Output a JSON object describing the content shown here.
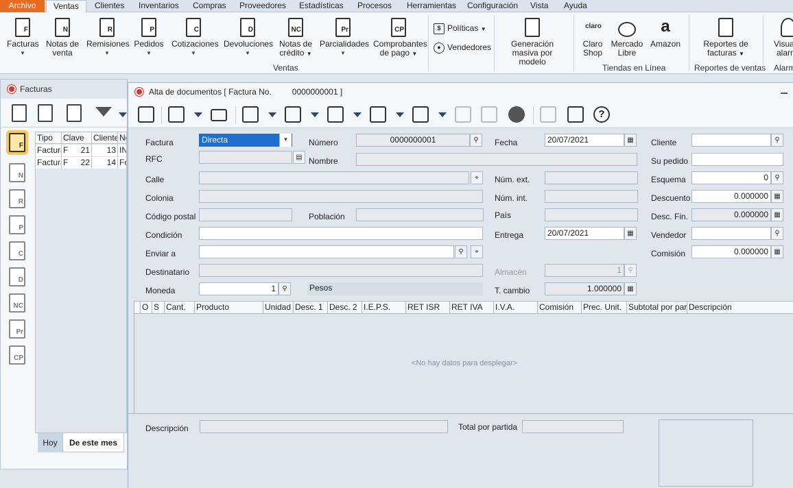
{
  "menu": {
    "tabs": [
      "Archivo",
      "Ventas",
      "Clientes",
      "Inventarios",
      "Compras",
      "Proveedores",
      "Estadísticas",
      "Procesos",
      "Herramientas",
      "Configuración",
      "Vista",
      "Ayuda"
    ]
  },
  "ribbon": {
    "facturas": {
      "label": "Facturas",
      "glyph": "F"
    },
    "notas_venta": {
      "label1": "Notas de",
      "label2": "venta",
      "glyph": "N"
    },
    "remisiones": {
      "label": "Remisiones",
      "glyph": "R"
    },
    "pedidos": {
      "label": "Pedidos",
      "glyph": "P"
    },
    "cotizaciones": {
      "label": "Cotizaciones",
      "glyph": "C"
    },
    "devoluciones": {
      "label": "Devoluciones",
      "glyph": "D"
    },
    "notas_credito": {
      "label1": "Notas de",
      "label2": "crédito",
      "glyph": "NC"
    },
    "parcialidades": {
      "label": "Parcialidades",
      "glyph": "Pr"
    },
    "comprobantes": {
      "label1": "Comprobantes",
      "label2": "de pago",
      "glyph": "CP"
    },
    "politicas": "Políticas",
    "vendedores": "Vendedores",
    "generacion": {
      "label1": "Generación",
      "label2": "masiva por modelo"
    },
    "ventas_group": "Ventas",
    "claro_shop": {
      "label1": "Claro",
      "label2": "Shop"
    },
    "mercado_libre": {
      "label1": "Mercado",
      "label2": "Libre"
    },
    "amazon": "Amazon",
    "tiendas_group": "Tiendas en Línea",
    "reportes_facturas": {
      "label1": "Reportes de",
      "label2": "facturas"
    },
    "reportes_group": "Reportes de ventas",
    "visual": {
      "label1": "Visual",
      "label2": "alarm"
    },
    "alarm_group": "Alarm"
  },
  "facturas_panel": {
    "title": "Facturas",
    "columns": [
      "Tipo",
      "Clave",
      "Cliente",
      "No"
    ],
    "rows": [
      [
        "Factura",
        "F",
        "21",
        "13",
        "INI"
      ],
      [
        "Factura",
        "F",
        "22",
        "14",
        "Fo"
      ]
    ],
    "side_icons": [
      "F",
      "N",
      "R",
      "P",
      "C",
      "D",
      "NC",
      "Pr",
      "CP"
    ],
    "tab_hoy": "Hoy",
    "tab_mes": "De este mes"
  },
  "document": {
    "title": "Alta de documentos [ Factura No.",
    "title_number": "0000000001 ]",
    "fields": {
      "factura_label": "Factura",
      "factura_value": "Directa",
      "numero_label": "Número",
      "numero_value": "0000000001",
      "fecha_label": "Fecha",
      "fecha_value": "20/07/2021",
      "cliente_label": "Cliente",
      "rfc_label": "RFC",
      "nombre_label": "Nombre",
      "su_pedido_label": "Su pedido",
      "calle_label": "Calle",
      "num_ext_label": "Núm. ext.",
      "esquema_label": "Esquema",
      "esquema_value": "0",
      "colonia_label": "Colonia",
      "num_int_label": "Núm. int.",
      "descuento_label": "Descuento",
      "descuento_value": "0.000000",
      "cp_label": "Código postal",
      "poblacion_label": "Población",
      "pais_label": "País",
      "desc_fin_label": "Desc. Fin.",
      "desc_fin_value": "0.000000",
      "condicion_label": "Condición",
      "entrega_label": "Entrega",
      "entrega_value": "20/07/2021",
      "vendedor_label": "Vendedor",
      "enviar_label": "Enviar a",
      "comision_label": "Comisión",
      "comision_value": "0.000000",
      "destinatario_label": "Destinatario",
      "almacen_label": "Almacén",
      "almacen_value": "1",
      "moneda_label": "Moneda",
      "moneda_value": "1",
      "moneda_name": "Pesos",
      "tcambio_label": "T. cambio",
      "tcambio_value": "1.000000"
    },
    "grid": {
      "columns": [
        "O",
        "S",
        "Cant.",
        "Producto",
        "Unidad",
        "Desc. 1",
        "Desc. 2",
        "I.E.P.S.",
        "RET ISR",
        "RET IVA",
        "I.V.A.",
        "Comisión",
        "Prec. Unit.",
        "Subtotal por partida",
        "Descripción"
      ],
      "empty": "<No hay datos para desplegar>"
    },
    "footer": {
      "descripcion_label": "Descripción",
      "total_label": "Total por partida"
    }
  }
}
